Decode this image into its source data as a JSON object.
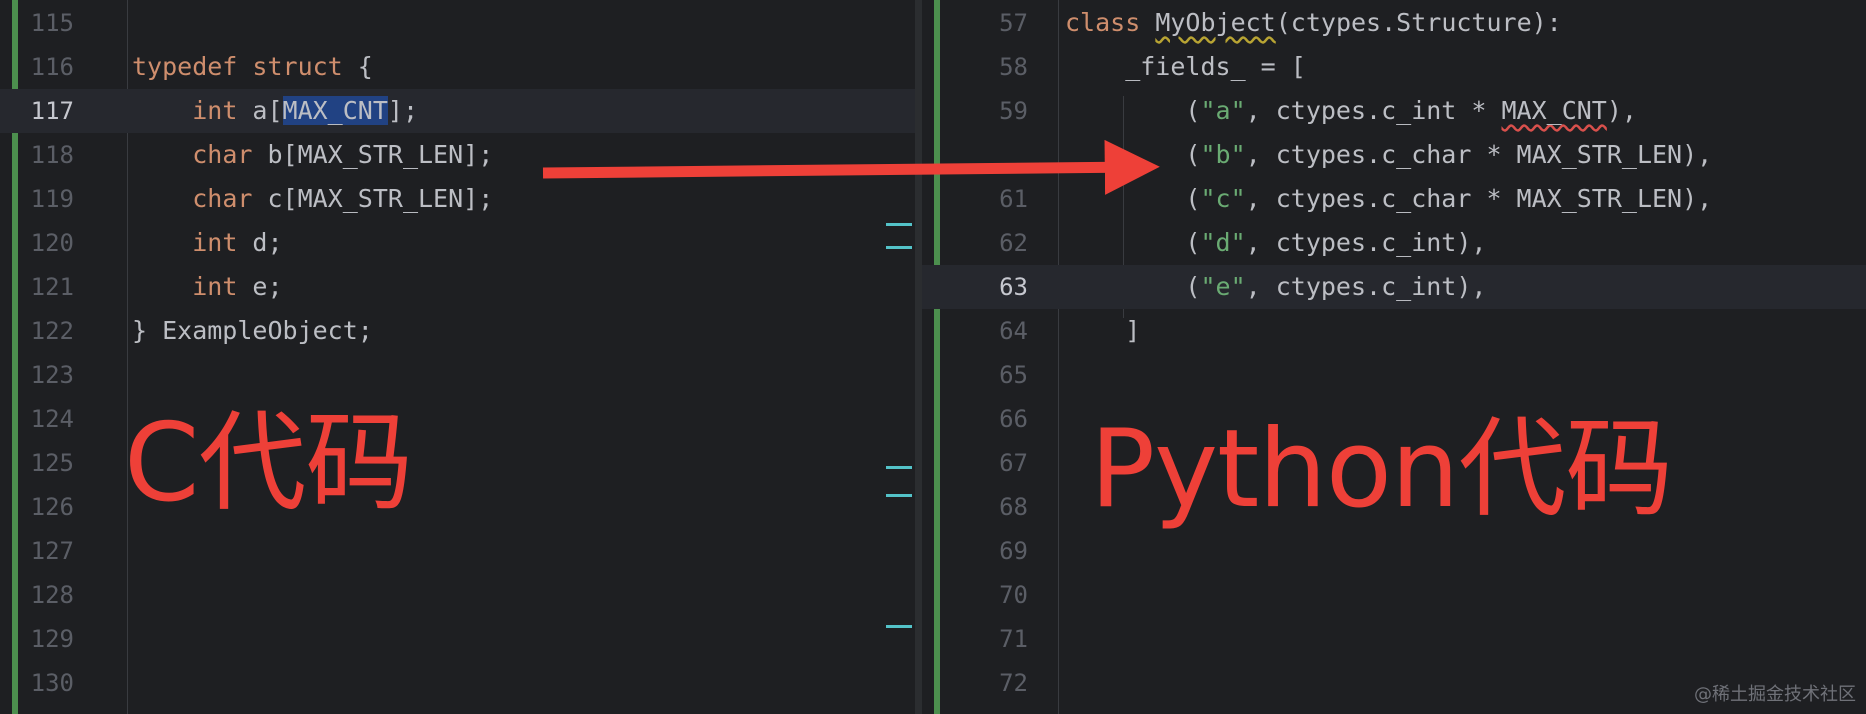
{
  "left_editor": {
    "lines": [
      {
        "num": "115",
        "tokens": []
      },
      {
        "num": "116",
        "tokens": [
          {
            "t": "typedef",
            "c": "kw"
          },
          {
            "t": " ",
            "c": ""
          },
          {
            "t": "struct",
            "c": "kw"
          },
          {
            "t": " {",
            "c": ""
          }
        ]
      },
      {
        "num": "117",
        "current": true,
        "tokens": [
          {
            "t": "    ",
            "c": ""
          },
          {
            "t": "int",
            "c": "kw"
          },
          {
            "t": " a[",
            "c": ""
          },
          {
            "t": "MAX_CNT",
            "c": "sel"
          },
          {
            "t": "];",
            "c": ""
          }
        ]
      },
      {
        "num": "118",
        "tokens": [
          {
            "t": "    ",
            "c": ""
          },
          {
            "t": "char",
            "c": "kw"
          },
          {
            "t": " b[MAX_STR_LEN];",
            "c": ""
          }
        ]
      },
      {
        "num": "119",
        "tokens": [
          {
            "t": "    ",
            "c": ""
          },
          {
            "t": "char",
            "c": "kw"
          },
          {
            "t": " c[MAX_STR_LEN];",
            "c": ""
          }
        ]
      },
      {
        "num": "120",
        "tokens": [
          {
            "t": "    ",
            "c": ""
          },
          {
            "t": "int",
            "c": "kw"
          },
          {
            "t": " d;",
            "c": ""
          }
        ]
      },
      {
        "num": "121",
        "tokens": [
          {
            "t": "    ",
            "c": ""
          },
          {
            "t": "int",
            "c": "kw"
          },
          {
            "t": " e;",
            "c": ""
          }
        ]
      },
      {
        "num": "122",
        "tokens": [
          {
            "t": "} ExampleObject;",
            "c": ""
          }
        ]
      },
      {
        "num": "123",
        "tokens": []
      },
      {
        "num": "124",
        "tokens": []
      },
      {
        "num": "125",
        "tokens": []
      },
      {
        "num": "126",
        "tokens": []
      },
      {
        "num": "127",
        "tokens": []
      },
      {
        "num": "128",
        "tokens": []
      },
      {
        "num": "129",
        "tokens": []
      },
      {
        "num": "130",
        "tokens": []
      }
    ]
  },
  "right_editor": {
    "lines": [
      {
        "num": "57",
        "tokens": [
          {
            "t": "class",
            "c": "kw"
          },
          {
            "t": " ",
            "c": ""
          },
          {
            "t": "MyObject",
            "c": "squiggle-yellow"
          },
          {
            "t": "(ctypes.Structure):",
            "c": ""
          }
        ]
      },
      {
        "num": "58",
        "tokens": [
          {
            "t": "    _fields_ = [",
            "c": ""
          }
        ]
      },
      {
        "num": "59",
        "tokens": [
          {
            "t": "        (",
            "c": ""
          },
          {
            "t": "\"a\"",
            "c": "str"
          },
          {
            "t": ", ctypes.c_int * ",
            "c": ""
          },
          {
            "t": "MAX_CNT",
            "c": "squiggle-red"
          },
          {
            "t": "),",
            "c": ""
          }
        ]
      },
      {
        "num": "",
        "tokens": [
          {
            "t": "        (",
            "c": ""
          },
          {
            "t": "\"b\"",
            "c": "str"
          },
          {
            "t": ", ctypes.c_char * MAX_STR_LEN),",
            "c": ""
          }
        ]
      },
      {
        "num": "61",
        "tokens": [
          {
            "t": "        (",
            "c": ""
          },
          {
            "t": "\"c\"",
            "c": "str"
          },
          {
            "t": ", ctypes.c_char * MAX_STR_LEN),",
            "c": ""
          }
        ]
      },
      {
        "num": "62",
        "tokens": [
          {
            "t": "        (",
            "c": ""
          },
          {
            "t": "\"d\"",
            "c": "str"
          },
          {
            "t": ", ctypes.c_int),",
            "c": ""
          }
        ]
      },
      {
        "num": "63",
        "current": true,
        "tokens": [
          {
            "t": "        (",
            "c": ""
          },
          {
            "t": "\"e\"",
            "c": "str"
          },
          {
            "t": ", ctypes.c_int),",
            "c": ""
          }
        ]
      },
      {
        "num": "64",
        "tokens": [
          {
            "t": "    ]",
            "c": ""
          }
        ]
      },
      {
        "num": "65",
        "tokens": []
      },
      {
        "num": "66",
        "tokens": []
      },
      {
        "num": "67",
        "tokens": []
      },
      {
        "num": "68",
        "tokens": []
      },
      {
        "num": "69",
        "tokens": []
      },
      {
        "num": "70",
        "tokens": []
      },
      {
        "num": "71",
        "tokens": []
      },
      {
        "num": "72",
        "tokens": []
      }
    ]
  },
  "annotations": {
    "left_label": "C代码",
    "right_label": "Python代码",
    "arrow_color": "#ee4038"
  },
  "watermark": "@稀土掘金技术社区",
  "colors": {
    "background": "#1e1f22",
    "keyword": "#cf8e6d",
    "string": "#6aab73",
    "text": "#bcbec4",
    "line_number": "#5b5e66",
    "vcs_change": "#4c8f4e",
    "selection": "#214283"
  }
}
